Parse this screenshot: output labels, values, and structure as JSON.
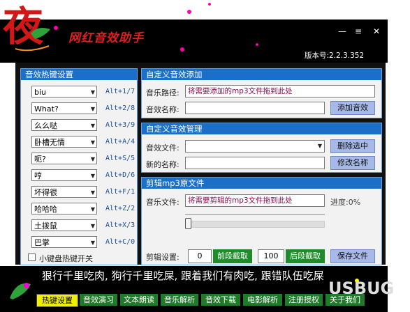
{
  "app": {
    "title": "网红音效助手",
    "version": "版本号:2.2.3.352",
    "logo_text": "夜"
  },
  "window_controls": {
    "minimize": "—",
    "menu": "≡",
    "close": "✕"
  },
  "hotkey_panel": {
    "title": "音效热键设置",
    "rows": [
      {
        "value": "biu",
        "hotkey": "Alt+1/7"
      },
      {
        "value": "What?",
        "hotkey": "Alt+2/8"
      },
      {
        "value": "么么哒",
        "hotkey": "Alt+3/9"
      },
      {
        "value": "卧槽无情",
        "hotkey": "Alt+A/4"
      },
      {
        "value": "呃?",
        "hotkey": "Alt+S/5"
      },
      {
        "value": "哼",
        "hotkey": "Alt+D/6"
      },
      {
        "value": "坏得很",
        "hotkey": "Alt+F/1"
      },
      {
        "value": "哈哈哈",
        "hotkey": "Alt+Z/2"
      },
      {
        "value": "土拨鼠",
        "hotkey": "Alt+X/3"
      },
      {
        "value": "巴掌",
        "hotkey": "Alt+C/0"
      }
    ],
    "keyboard_toggle_label": "小键盘热键开关"
  },
  "add_panel": {
    "title": "自定义音效添加",
    "path_label": "音乐路径:",
    "path_value": "将需要添加的mp3文件拖到此处",
    "name_label": "音效名称:",
    "name_value": "",
    "add_button": "添加音效"
  },
  "manage_panel": {
    "title": "自定义音效管理",
    "file_label": "音效文件:",
    "file_value": "",
    "newname_label": "新的名称:",
    "newname_value": "",
    "delete_button": "删除选中",
    "rename_button": "修改名称"
  },
  "cut_panel": {
    "title": "剪辑mp3原文件",
    "file_label": "音乐文件:",
    "file_value": "将需要剪辑的mp3文件拖到此处",
    "progress_label": "进度:0%",
    "settings_label": "剪辑设置:",
    "start_value": "0",
    "front_button": "前段截取",
    "end_value": "100",
    "back_button": "后段截取",
    "save_button": "保存文件",
    "slider_level": 0
  },
  "marquee_text": "狠行千里吃肉, 狗行千里吃屎, 跟着我们有肉吃, 跟错队伍吃屎",
  "nav_tabs": [
    "热键设置",
    "音效演习",
    "文本朗读",
    "音乐解析",
    "音效下载",
    "电影解析",
    "注册授权",
    "关于我们"
  ],
  "watermark": "USBUG",
  "colors": {
    "panel_header": "#1b6fc9",
    "nav_tab": "#1f7a2a",
    "active_tab": "#f0f000",
    "green_button": "#1f8b2a",
    "blue_button": "#a7b9e8"
  }
}
